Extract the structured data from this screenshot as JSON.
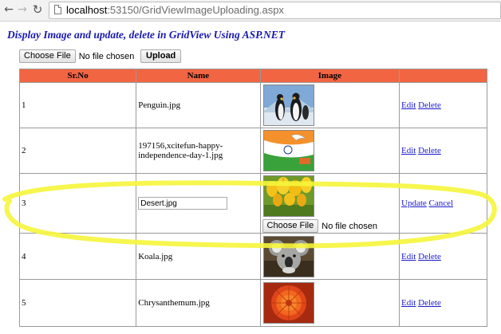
{
  "browser": {
    "url_host": "localhost",
    "url_path": ":53150/GridViewImageUploading.aspx"
  },
  "page": {
    "heading": "Display Image and update, delete in GridView Using ASP.NET",
    "choose_file_label": "Choose File",
    "no_file_text": "No file chosen",
    "upload_label": "Upload"
  },
  "grid": {
    "headers": {
      "sr": "Sr.No",
      "name": "Name",
      "image": "Image"
    },
    "rows": [
      {
        "sr": "1",
        "name": "Penguin.jpg",
        "edit": "Edit",
        "delete": "Delete"
      },
      {
        "sr": "2",
        "name": "197156,xcitefun-happy-independence-day-1.jpg",
        "edit": "Edit",
        "delete": "Delete"
      },
      {
        "sr": "3",
        "name_value": "Desert.jpg",
        "update": "Update",
        "cancel": "Cancel",
        "choose_file_label": "Choose File",
        "no_file_text": "No file chosen"
      },
      {
        "sr": "4",
        "name": "Koala.jpg",
        "edit": "Edit",
        "delete": "Delete"
      },
      {
        "sr": "5",
        "name": "Chrysanthemum.jpg",
        "edit": "Edit",
        "delete": "Delete"
      }
    ]
  },
  "colors": {
    "header_bg": "#f26543",
    "heading": "#1a19b0",
    "link": "#1a19cc",
    "highlight": "#f5f53b"
  }
}
